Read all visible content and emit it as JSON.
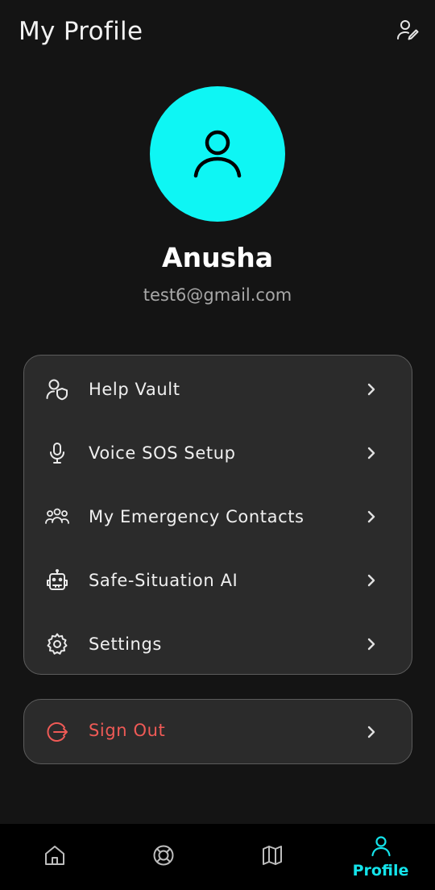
{
  "header": {
    "title": "My Profile",
    "edit_icon": "edit-profile-icon"
  },
  "profile": {
    "avatar_icon": "user-icon",
    "avatar_color": "#0ef6f4",
    "name": "Anusha",
    "email": "test6@gmail.com"
  },
  "menu": {
    "items": [
      {
        "label": "Help Vault",
        "icon": "user-shield-icon"
      },
      {
        "label": "Voice SOS Setup",
        "icon": "microphone-icon"
      },
      {
        "label": "My Emergency Contacts",
        "icon": "group-icon"
      },
      {
        "label": "Safe-Situation AI",
        "icon": "robot-icon"
      },
      {
        "label": "Settings",
        "icon": "gear-icon"
      }
    ]
  },
  "signout": {
    "label": "Sign Out",
    "icon": "logout-icon",
    "color": "#ef5a56"
  },
  "bottom_nav": {
    "items": [
      {
        "icon": "home-icon",
        "label": ""
      },
      {
        "icon": "lifebuoy-icon",
        "label": ""
      },
      {
        "icon": "map-icon",
        "label": ""
      },
      {
        "icon": "profile-icon",
        "label": "Profile",
        "active": true
      }
    ],
    "active_color": "#14e3ea"
  }
}
